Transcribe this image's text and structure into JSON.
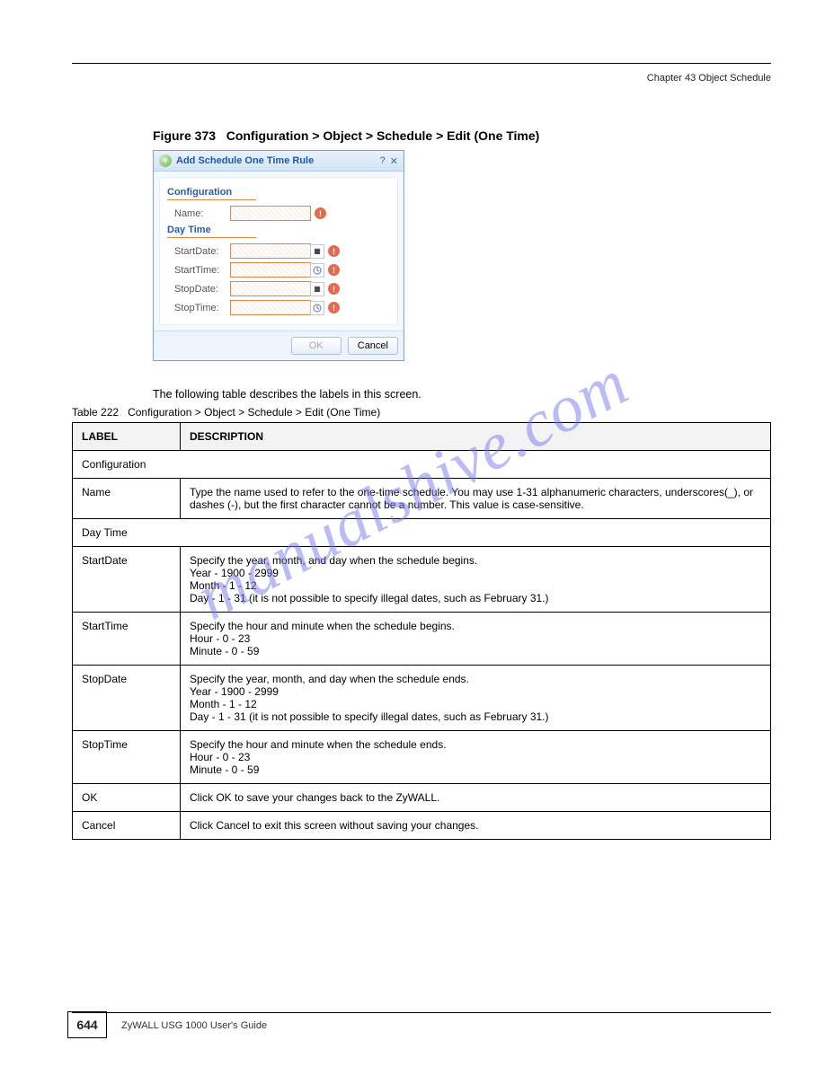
{
  "header": {
    "chapter_line": "Chapter 43 Object",
    "short_title": "Schedule"
  },
  "figure": {
    "number_label": "Figure 373",
    "title": "Configuration > Object > Schedule > Edit (One Time)"
  },
  "dialog": {
    "title": "Add Schedule One Time Rule",
    "sections": {
      "config": {
        "heading": "Configuration",
        "name_label": "Name:"
      },
      "daytime": {
        "heading": "Day Time",
        "startdate_label": "StartDate:",
        "starttime_label": "StartTime:",
        "stopdate_label": "StopDate:",
        "stoptime_label": "StopTime:"
      }
    },
    "buttons": {
      "ok": "OK",
      "cancel": "Cancel"
    }
  },
  "intro_text": "The following table describes the labels in this screen.",
  "table": {
    "caption_prefix": "Table 222",
    "caption_title": "Configuration > Object > Schedule > Edit (One Time)",
    "columns": {
      "label": "LABEL",
      "desc": "DESCRIPTION"
    },
    "groups": [
      {
        "group_label": "Configuration",
        "rows": [
          {
            "label": "Name",
            "desc": "Type the name used to refer to the one-time schedule. You may use 1-31 alphanumeric characters, underscores(_), or dashes (-), but the first character cannot be a number. This value is case-sensitive."
          }
        ]
      },
      {
        "group_label": "Day Time",
        "rows": [
          {
            "label": "StartDate",
            "desc": "Specify the year, month, and day when the schedule begins.\nYear - 1900 - 2999\nMonth - 1 - 12\nDay - 1 - 31 (it is not possible to specify illegal dates, such as February 31.)"
          },
          {
            "label": "StartTime",
            "desc": "Specify the hour and minute when the schedule begins.\nHour - 0 - 23\nMinute - 0 - 59"
          },
          {
            "label": "StopDate",
            "desc": "Specify the year, month, and day when the schedule ends.\nYear - 1900 - 2999\nMonth - 1 - 12\nDay - 1 - 31 (it is not possible to specify illegal dates, such as February 31.)"
          },
          {
            "label": "StopTime",
            "desc": "Specify the hour and minute when the schedule ends.\nHour - 0 - 23\nMinute - 0 - 59"
          },
          {
            "label": "OK",
            "desc": "Click OK to save your changes back to the ZyWALL."
          },
          {
            "label": "Cancel",
            "desc": "Click Cancel to exit this screen without saving your changes."
          }
        ]
      }
    ]
  },
  "footer": {
    "page_number": "644",
    "guide_text": "ZyWALL USG 1000 User's Guide"
  },
  "watermark": "manualshive.com"
}
